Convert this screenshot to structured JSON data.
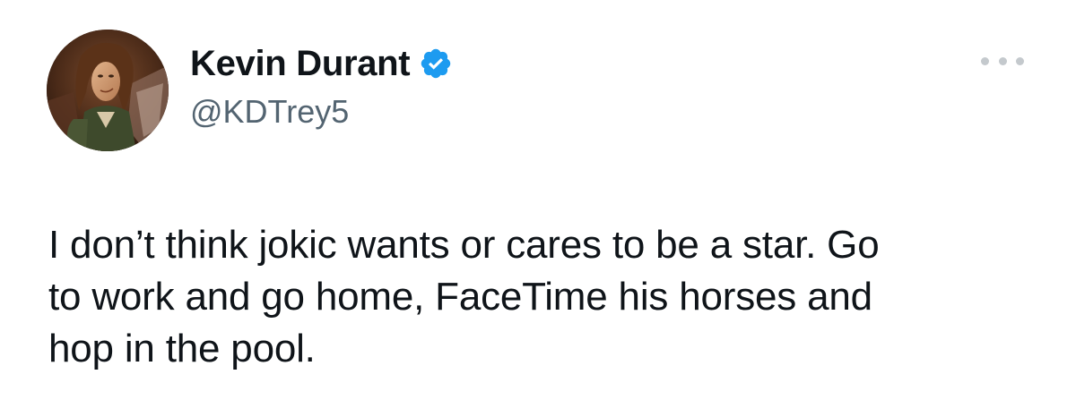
{
  "tweet": {
    "author": {
      "display_name": "Kevin Durant",
      "handle": "@KDTrey5",
      "verified": true,
      "verified_badge_color": "#1d9bf0",
      "avatar_icon": "animated-character-avatar"
    },
    "more_icon": "more-options-icon",
    "text_lines": [
      "I don’t think jokic wants or cares to be a star. Go",
      "to work and go home, FaceTime his horses and",
      "hop in the pool."
    ]
  },
  "colors": {
    "text_primary": "#0f1419",
    "text_secondary": "#536471",
    "background": "#ffffff"
  }
}
